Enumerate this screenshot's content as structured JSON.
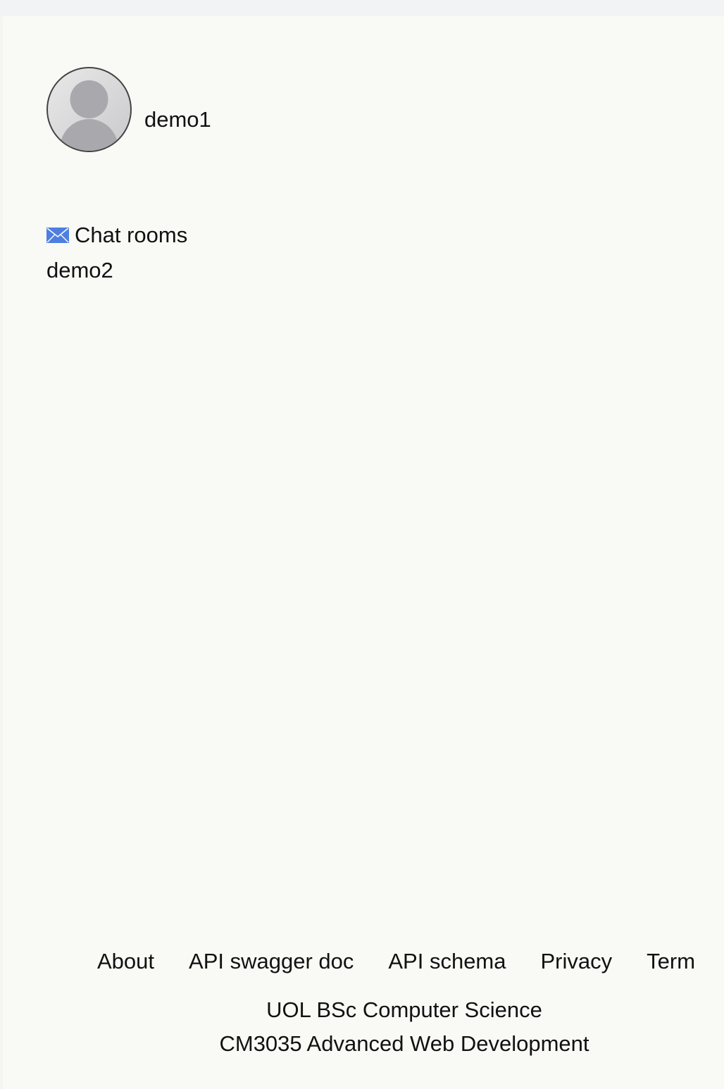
{
  "profile": {
    "username": "demo1",
    "avatar_icon": "person-silhouette-icon"
  },
  "chat": {
    "title": "Chat rooms",
    "icon": "envelope-icon",
    "icon_color": "#4e7fe0",
    "rooms": [
      {
        "label": "demo2"
      }
    ]
  },
  "footer": {
    "links": [
      {
        "label": "About"
      },
      {
        "label": "API swagger doc"
      },
      {
        "label": "API schema"
      },
      {
        "label": "Privacy"
      },
      {
        "label": "Term"
      }
    ],
    "line1": "UOL BSc Computer Science",
    "line2": "CM3035 Advanced Web Development"
  }
}
